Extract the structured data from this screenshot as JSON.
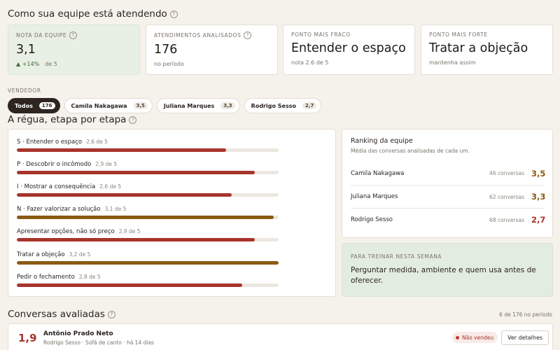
{
  "titles": {
    "top": "Como sua equipe está atendendo",
    "regua": "A régua, etapa por etapa",
    "conversas": "Conversas avaliadas"
  },
  "kpis": [
    {
      "label": "NOTA DA EQUIPE",
      "value": "3,1",
      "delta": "+14%",
      "sub": "de 5",
      "help": true
    },
    {
      "label": "ATENDIMENTOS ANALISADOS",
      "value": "176",
      "sub": "no período",
      "help": true
    },
    {
      "label": "PONTO MAIS FRACO",
      "value": "Entender o espaço",
      "sub": "nota 2.6 de 5"
    },
    {
      "label": "PONTO MAIS FORTE",
      "value": "Tratar a objeção",
      "sub": "mantenha assim"
    }
  ],
  "vendedor": {
    "label": "VENDEDOR",
    "chips": [
      {
        "name": "Todos",
        "count": "176",
        "active": true
      },
      {
        "name": "Camila Nakagawa",
        "count": "3,5"
      },
      {
        "name": "Juliana Marques",
        "count": "3,3"
      },
      {
        "name": "Rodrigo Sesso",
        "count": "2,7"
      }
    ]
  },
  "etapas": [
    {
      "name": "S · Entender o espaço",
      "score": "2,6 de 5",
      "fraction": 0.8,
      "color": "#a8342b"
    },
    {
      "name": "P · Descobrir o incômodo",
      "score": "2,9 de 5",
      "fraction": 0.91,
      "color": "#a8342b"
    },
    {
      "name": "I · Mostrar a consequência",
      "score": "2,6 de 5",
      "fraction": 0.82,
      "color": "#a8342b"
    },
    {
      "name": "N · Fazer valorizar a solução",
      "score": "3,1 de 5",
      "fraction": 0.98,
      "color": "#8a5a12"
    },
    {
      "name": "Apresentar opções, não só preço",
      "score": "2,9 de 5",
      "fraction": 0.91,
      "color": "#a8342b"
    },
    {
      "name": "Tratar a objeção",
      "score": "3,2 de 5",
      "fraction": 1.0,
      "color": "#8a5a12"
    },
    {
      "name": "Pedir o fechamento",
      "score": "2,8 de 5",
      "fraction": 0.86,
      "color": "#a8342b"
    }
  ],
  "ranking": {
    "title": "Ranking da equipe",
    "desc": "Média das conversas analisadas de cada um.",
    "rows": [
      {
        "name": "Camila Nakagawa",
        "count": "46 conversas",
        "score": "3,5",
        "color": "#8a5a12"
      },
      {
        "name": "Juliana Marques",
        "count": "62 conversas",
        "score": "3,3",
        "color": "#8a5a12"
      },
      {
        "name": "Rodrigo Sesso",
        "count": "68 conversas",
        "score": "2,7",
        "color": "#a8342b"
      }
    ]
  },
  "treinar": {
    "label": "PARA TREINAR NESTA SEMANA",
    "text": "Perguntar medida, ambiente e quem usa antes de oferecer."
  },
  "conversas": {
    "count": "6 de 176 no período",
    "rows": [
      {
        "score": "1,9",
        "name": "Antônio Prado Neto",
        "meta": "Rodrigo Sesso · Sofá de canto · há 14 dias",
        "badge": "Não vendeu",
        "action": "Ver detalhes"
      }
    ]
  }
}
